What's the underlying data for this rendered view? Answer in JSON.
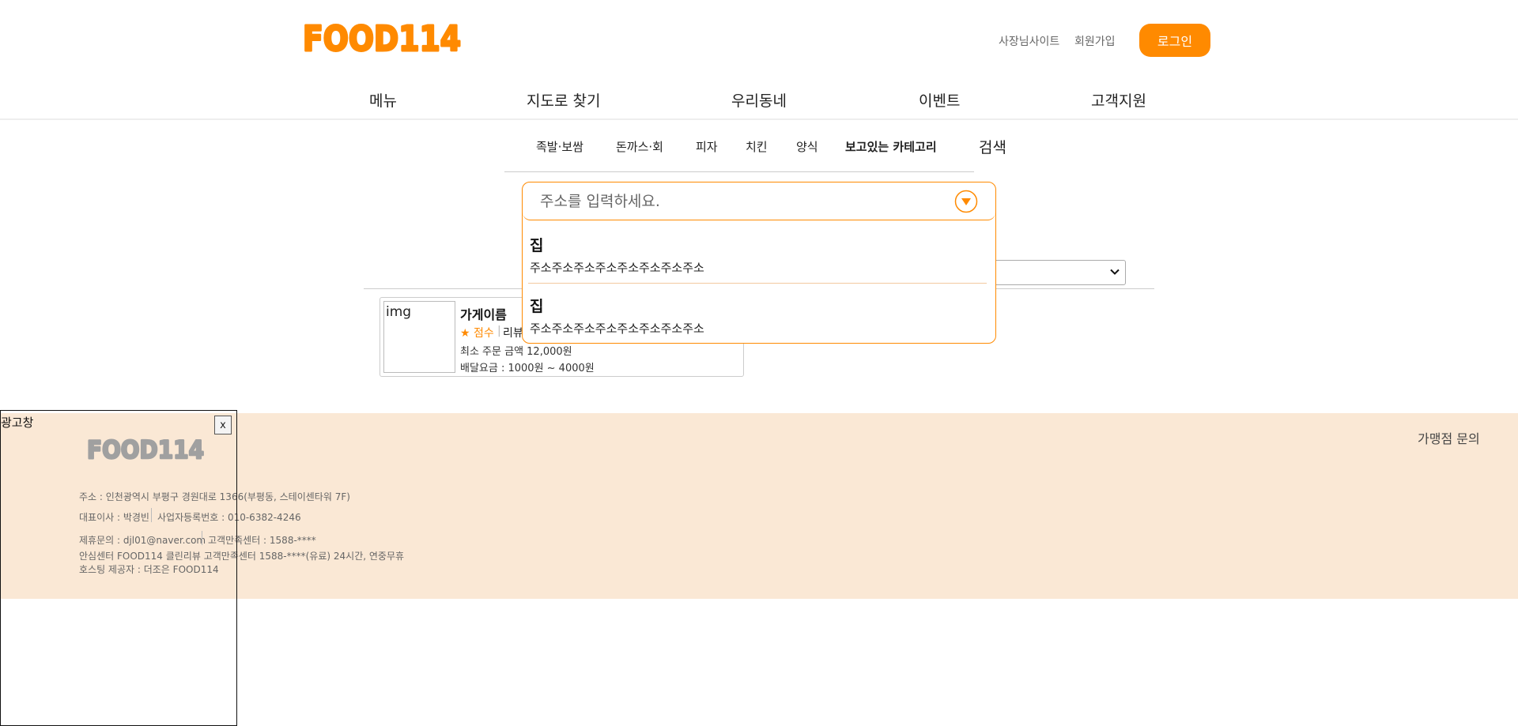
{
  "header": {
    "logo_text": "FOOD114",
    "owner_site": "사장님사이트",
    "signup": "회원가입",
    "login": "로그인"
  },
  "gnb": [
    "메뉴",
    "지도로 찾기",
    "우리동네",
    "이벤트",
    "고객지원"
  ],
  "categories": [
    "족발·보쌈",
    "돈까스·회",
    "피자",
    "치킨",
    "양식",
    "보고있는 카테고리"
  ],
  "category_search": "검색",
  "address": {
    "placeholder": "주소를 입력하세요.",
    "items": [
      {
        "title": "집",
        "address": "주소주소주소주소주소주소주소주소"
      },
      {
        "title": "집",
        "address": "주소주소주소주소주소주소주소주소"
      }
    ]
  },
  "store": {
    "img": "img",
    "name": "가게이름",
    "score": "★ 점수",
    "separator": "|",
    "review": "리뷰",
    "min_order": "최소 주문 금액 12,000원",
    "delivery_fee": "배달요금 : 1000원 ~ 4000원"
  },
  "footer": {
    "franchise": "가맹점 문의",
    "logo_text": "FOOD114",
    "address": "주소 : 인천광역시 부평구 경원대로 1366(부평동, 스테이센타워 7F)",
    "ceo": "대표이사 : 박경빈",
    "biz_no": "사업자등록번호 : 010-6382-4246",
    "partner": "제휴문의 : djl01@naver.com",
    "cs_center": "고객만족센터 : 1588-****",
    "safe_center": "안심센터 FOOD114 클린리뷰 고객만족센터 1588-****(유료) 24시간, 연중무휴",
    "hosting": "호스팅 제공자 : 더조은 FOOD114"
  },
  "ad": {
    "title": "광고창",
    "close": "x"
  },
  "colors": {
    "brand": "#ff8a00",
    "footer_bg": "#fae8d5",
    "footer_logo": "#a0a0a0"
  }
}
